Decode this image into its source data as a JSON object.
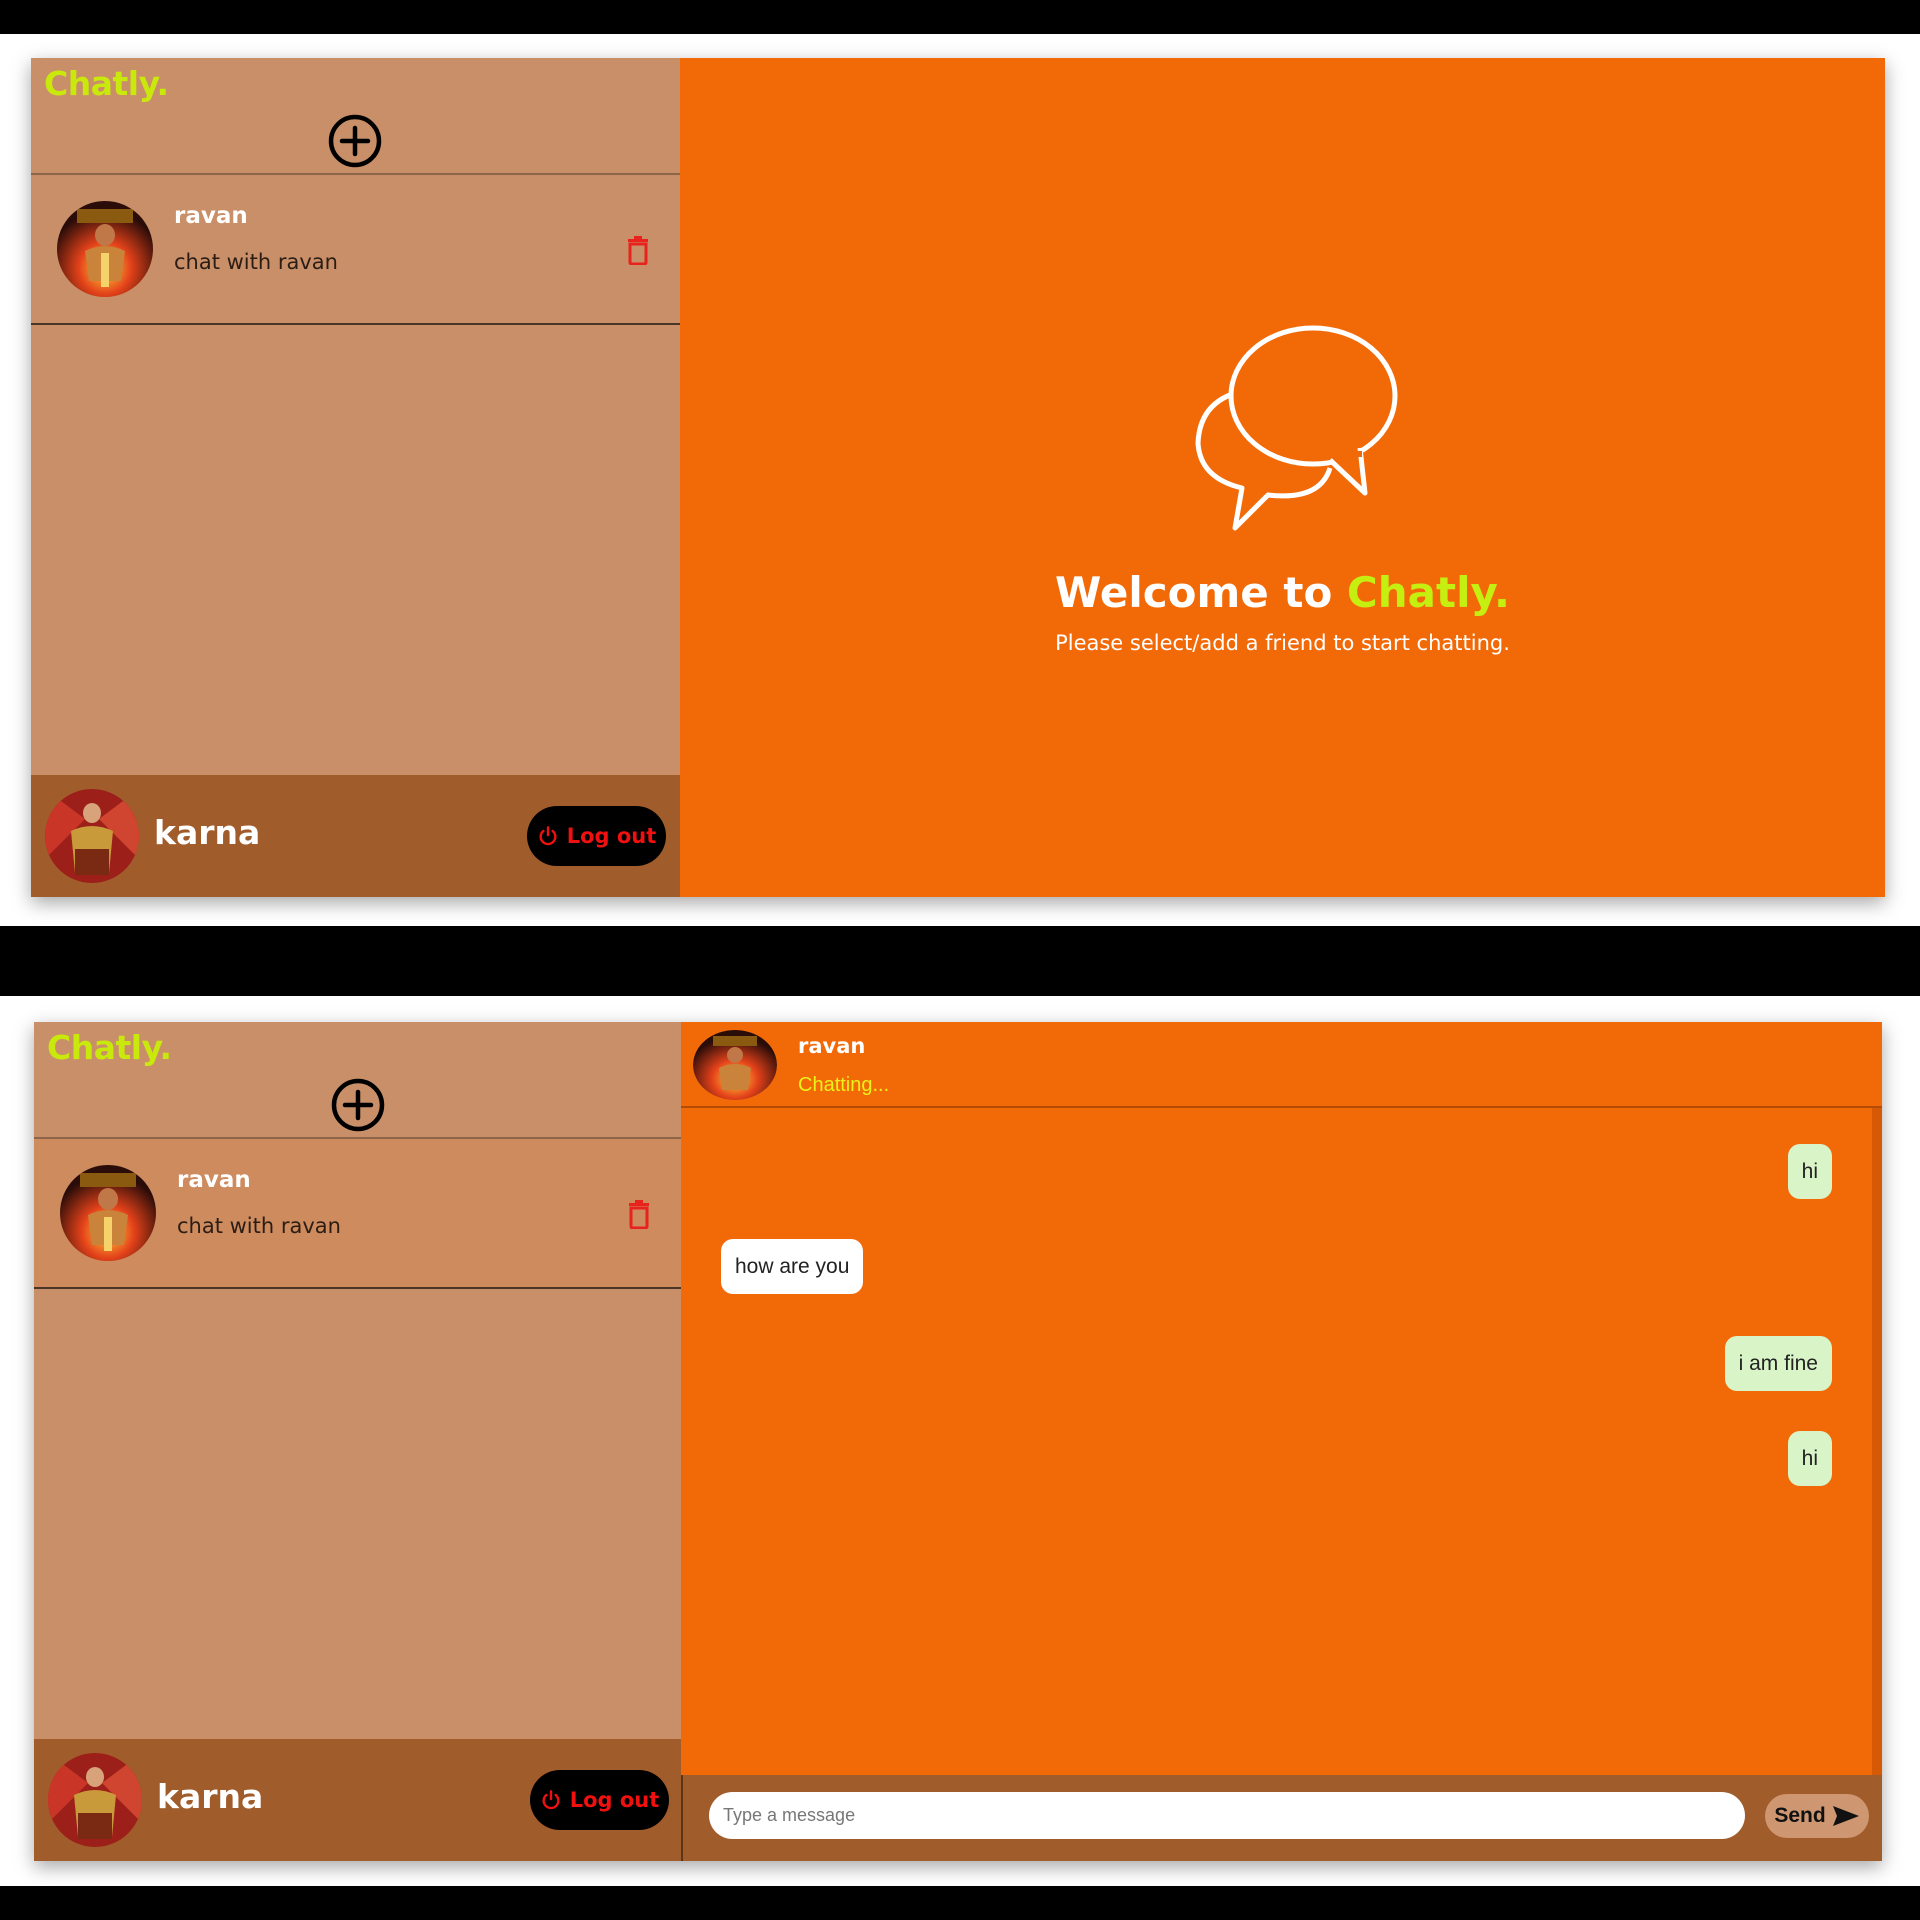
{
  "brand": "Chatly.",
  "colors": {
    "sidebar": "#c98f68",
    "sidebar_footer": "#a15c2b",
    "main": "#f26a08",
    "brand_accent": "#c9e80b",
    "delete": "#e8231d",
    "logout_text": "#f01010",
    "outgoing_bubble": "#d9f5c8",
    "incoming_bubble": "#ffffff"
  },
  "icons": {
    "add": "plus-circle-icon",
    "delete": "trash-icon",
    "logout": "power-icon",
    "welcome": "chat-bubbles-icon",
    "send": "send-arrow-icon"
  },
  "screen1": {
    "chat_list": [
      {
        "name": "ravan",
        "subtitle": "chat with ravan"
      }
    ],
    "current_user": {
      "name": "karna"
    },
    "logout_label": "Log out",
    "welcome": {
      "title_prefix": "Welcome to",
      "title_brand": "Chatly.",
      "subtitle": "Please select/add a friend to start chatting."
    }
  },
  "screen2": {
    "chat_list": [
      {
        "name": "ravan",
        "subtitle": "chat with ravan"
      }
    ],
    "current_user": {
      "name": "karna"
    },
    "logout_label": "Log out",
    "conversation": {
      "name": "ravan",
      "status": "Chatting...",
      "messages": [
        {
          "text": "hi",
          "direction": "outgoing"
        },
        {
          "text": "how are you",
          "direction": "incoming"
        },
        {
          "text": "i am fine",
          "direction": "outgoing"
        },
        {
          "text": "hi",
          "direction": "outgoing"
        }
      ]
    },
    "input": {
      "placeholder": "Type a message",
      "value": ""
    },
    "send_label": "Send"
  }
}
